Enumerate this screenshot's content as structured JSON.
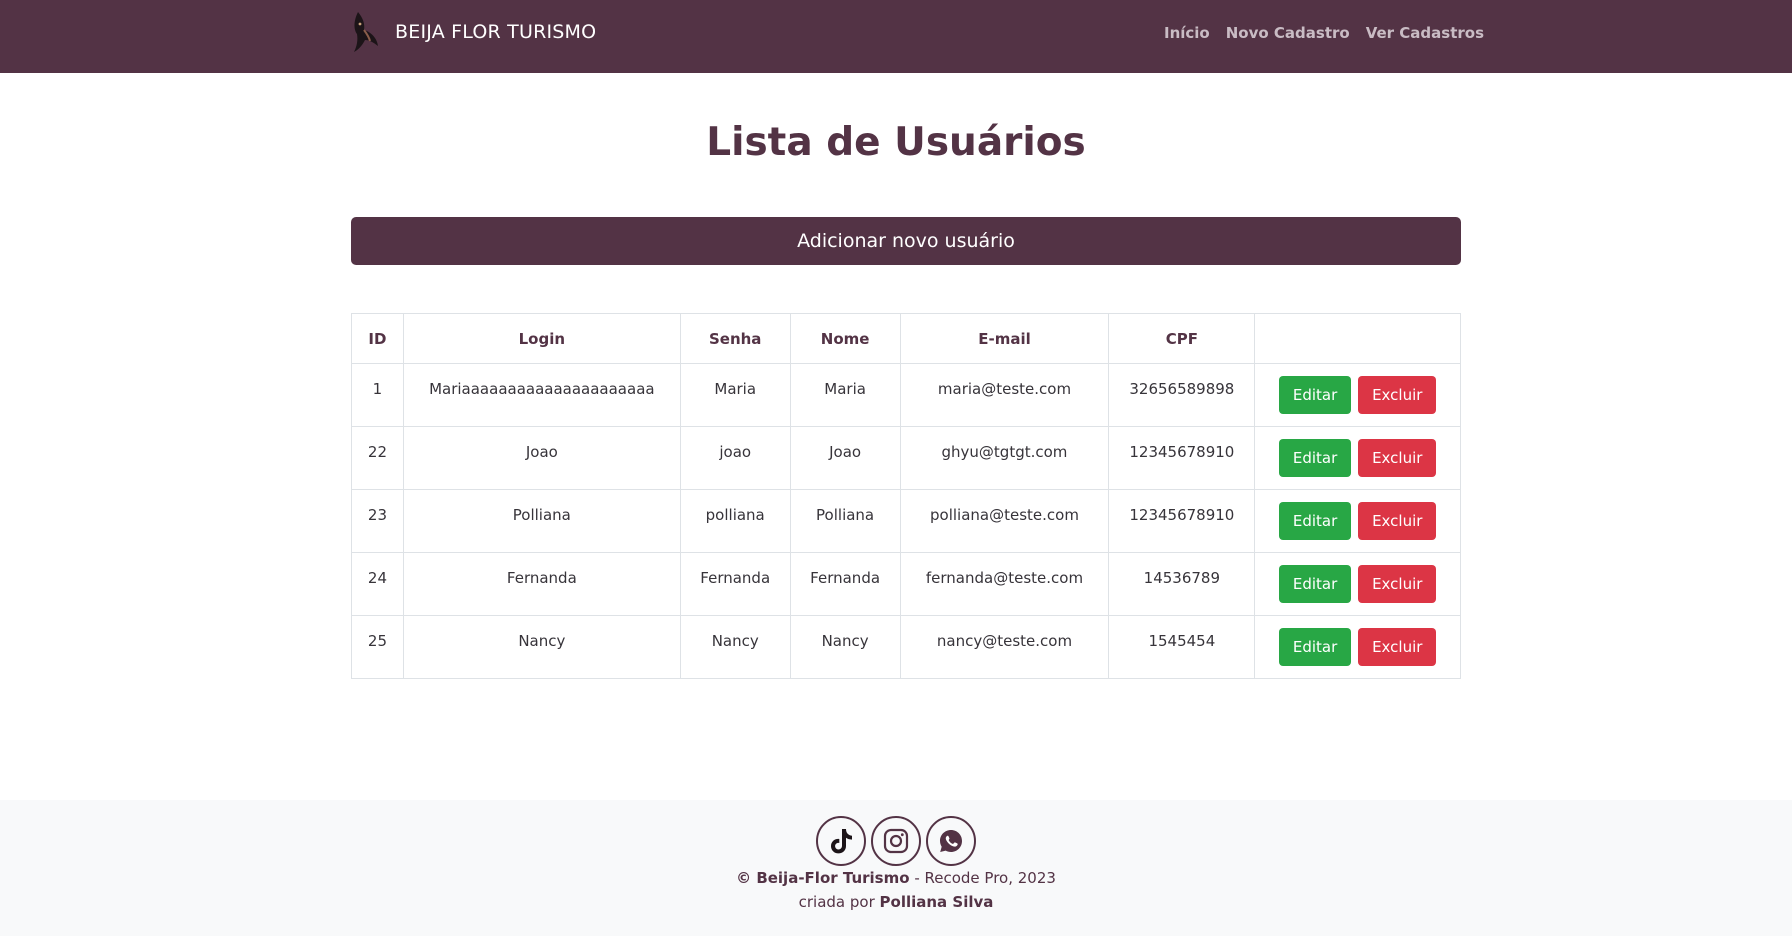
{
  "navbar": {
    "brand": "BEIJA FLOR TURISMO",
    "links": [
      "Início",
      "Novo Cadastro",
      "Ver Cadastros"
    ]
  },
  "page": {
    "title": "Lista de Usuários",
    "add_button": "Adicionar novo usuário"
  },
  "table": {
    "headers": [
      "ID",
      "Login",
      "Senha",
      "Nome",
      "E-mail",
      "CPF",
      ""
    ],
    "rows": [
      {
        "id": "1",
        "login": "Mariaaaaaaaaaaaaaaaaaaaaa",
        "senha": "Maria",
        "nome": "Maria",
        "email": "maria@teste.com",
        "cpf": "32656589898"
      },
      {
        "id": "22",
        "login": "Joao",
        "senha": "joao",
        "nome": "Joao",
        "email": "ghyu@tgtgt.com",
        "cpf": "12345678910"
      },
      {
        "id": "23",
        "login": "Polliana",
        "senha": "polliana",
        "nome": "Polliana",
        "email": "polliana@teste.com",
        "cpf": "12345678910"
      },
      {
        "id": "24",
        "login": "Fernanda",
        "senha": "Fernanda",
        "nome": "Fernanda",
        "email": "fernanda@teste.com",
        "cpf": "14536789"
      },
      {
        "id": "25",
        "login": "Nancy",
        "senha": "Nancy",
        "nome": "Nancy",
        "email": "nancy@teste.com",
        "cpf": "1545454"
      }
    ],
    "edit_label": "Editar",
    "delete_label": "Excluir"
  },
  "footer": {
    "social_icons": [
      "tiktok-icon",
      "instagram-icon",
      "whatsapp-icon"
    ],
    "copyright_symbol": "©",
    "company": "Beija-Flor Turismo",
    "separator": "- Recode Pro, 2023",
    "credit_prefix": "criada por",
    "author": "Polliana Silva"
  },
  "colors": {
    "brand": "#533345",
    "edit": "#28a745",
    "delete": "#dc3545",
    "footer_bg": "#f8f9fa"
  }
}
